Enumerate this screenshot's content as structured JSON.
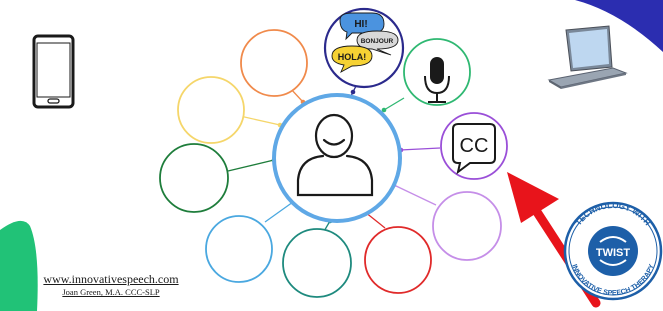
{
  "speech_bubbles": {
    "hi": "HI!",
    "bonjour": "BONJOUR",
    "hola": "HOLA!"
  },
  "cc_icon_text": "CC",
  "badge": {
    "top_text": "TECHNOLOGY WITH",
    "center_text": "TWIST",
    "bottom_text": "INNOVATIVE SPEECH THERAPY"
  },
  "footer": {
    "url": "www.innovativespeech.com",
    "author": "Joan Green, M.A. CCC-SLP"
  },
  "colors": {
    "center_ring": "#5fa8e6",
    "language_ring": "#2b2a8c",
    "microphone_ring": "#2fb872",
    "cc_ring": "#9a4fd8",
    "violet_ring": "#c58ee8",
    "red_ring": "#e02a2a",
    "teal_ring": "#1e8a7e",
    "skyblue_ring": "#4aa8e0",
    "darkgreen_ring": "#1e7d3b",
    "yellow_ring": "#f5d66a",
    "orange_ring": "#f08a4b",
    "arrow": "#e8141b",
    "corner_green": "#21c277",
    "corner_navy": "#2b2db0",
    "badge_blue": "#1d5fa8"
  },
  "icons": [
    "phone-icon",
    "laptop-icon",
    "person-icon",
    "microphone-icon",
    "closed-captions-icon",
    "speech-bubbles-icon",
    "arrow-icon",
    "twist-logo"
  ]
}
